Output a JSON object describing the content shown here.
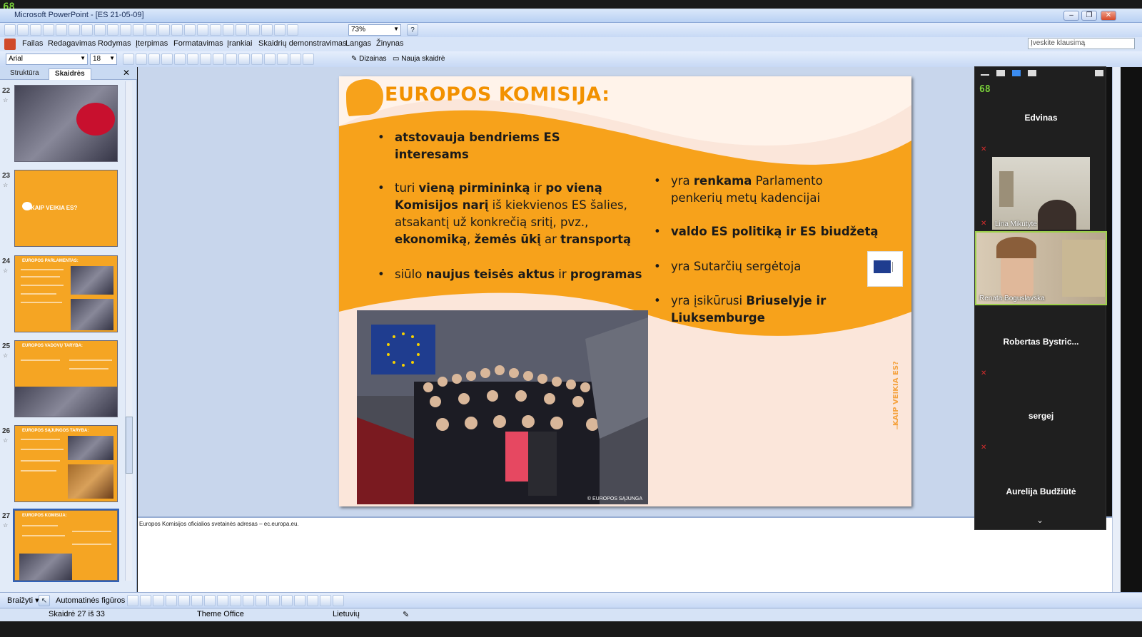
{
  "window": {
    "title": "Microsoft PowerPoint - [ES 21-05-09]",
    "logo": "68"
  },
  "toolbar": {
    "zoom": "73%"
  },
  "menu": [
    "Failas",
    "Redagavimas",
    "Rodymas",
    "Įterpimas",
    "Formatavimas",
    "Įrankiai",
    "Skaidrių demonstravimas",
    "Langas",
    "Žinynas"
  ],
  "help_placeholder": "Įveskite klausimą",
  "format": {
    "font": "Arial",
    "size": "18",
    "design_label": "Dizainas",
    "new_slide_label": "Nauja skaidrė"
  },
  "left_panel": {
    "tab_outline": "Struktūra",
    "tab_slides": "Skaidrės",
    "thumbs": [
      {
        "num": "22",
        "title": ""
      },
      {
        "num": "23",
        "title": "KAIP VEIKIA ES?"
      },
      {
        "num": "24",
        "title": "EUROPOS PARLAMENTAS:"
      },
      {
        "num": "25",
        "title": "EUROPOS VADOVŲ TARYBA:"
      },
      {
        "num": "26",
        "title": "EUROPOS SĄJUNGOS TARYBA:"
      },
      {
        "num": "27",
        "title": "EUROPOS KOMISIJA:"
      }
    ]
  },
  "slide": {
    "title": "EUROPOS KOMISIJA:",
    "left_bullets": [
      {
        "text_parts": [
          {
            "b": true,
            "t": "atstovauja bendriems ES interesams"
          }
        ]
      },
      {
        "text_parts": [
          {
            "b": false,
            "t": "turi "
          },
          {
            "b": true,
            "t": "vieną pirmininką"
          },
          {
            "b": false,
            "t": " ir "
          },
          {
            "b": true,
            "t": "po vieną Komisijos narį"
          },
          {
            "b": false,
            "t": " iš kiekvienos ES šalies, atsakantį už konkrečią sritį, pvz., "
          },
          {
            "b": true,
            "t": "ekonomiką"
          },
          {
            "b": false,
            "t": ", "
          },
          {
            "b": true,
            "t": "žemės ūkį"
          },
          {
            "b": false,
            "t": " ar "
          },
          {
            "b": true,
            "t": "transportą"
          }
        ]
      },
      {
        "text_parts": [
          {
            "b": false,
            "t": "siūlo "
          },
          {
            "b": true,
            "t": "naujus teisės aktus"
          },
          {
            "b": false,
            "t": " ir "
          },
          {
            "b": true,
            "t": "programas"
          }
        ]
      }
    ],
    "right_bullets": [
      {
        "text_parts": [
          {
            "b": false,
            "t": "yra "
          },
          {
            "b": true,
            "t": "renkama"
          },
          {
            "b": false,
            "t": " Parlamento penkerių metų kadencijai"
          }
        ]
      },
      {
        "text_parts": [
          {
            "b": true,
            "t": "valdo ES politiką ir ES biudžetą"
          }
        ]
      },
      {
        "text_parts": [
          {
            "b": false,
            "t": "yra Sutarčių sergėtoja"
          }
        ]
      },
      {
        "text_parts": [
          {
            "b": false,
            "t": "yra įsikūrusi "
          },
          {
            "b": true,
            "t": "Briuselyje ir Liuksemburge"
          }
        ]
      }
    ],
    "side_label": "KAIP VEIKIA ES?",
    "photo_credit": "© EUROPOS SĄJUNGA",
    "colors": {
      "orange": "#f7a21b",
      "title": "#f29100",
      "bg": "#fbe6da"
    }
  },
  "notes": "Europos Komisijos oficialios svetainės adresas – ec.europa.eu.",
  "draw": {
    "draw_label": "Braižyti",
    "autoshapes_label": "Automatinės figūros"
  },
  "status": {
    "slide": "Skaidrė 27 iš 33",
    "theme": "Theme Office",
    "lang": "Lietuvių"
  },
  "zoom_panel": {
    "participants": [
      {
        "name": "Edvinas",
        "video": false
      },
      {
        "name": "Lina Mikutytė",
        "video": true
      },
      {
        "name": "Renata Boguslavska",
        "video": true
      },
      {
        "name": "Robertas  Bystric...",
        "video": false
      },
      {
        "name": "sergej",
        "video": false
      },
      {
        "name": "Aurelija Budžiūtė",
        "video": false
      }
    ]
  }
}
